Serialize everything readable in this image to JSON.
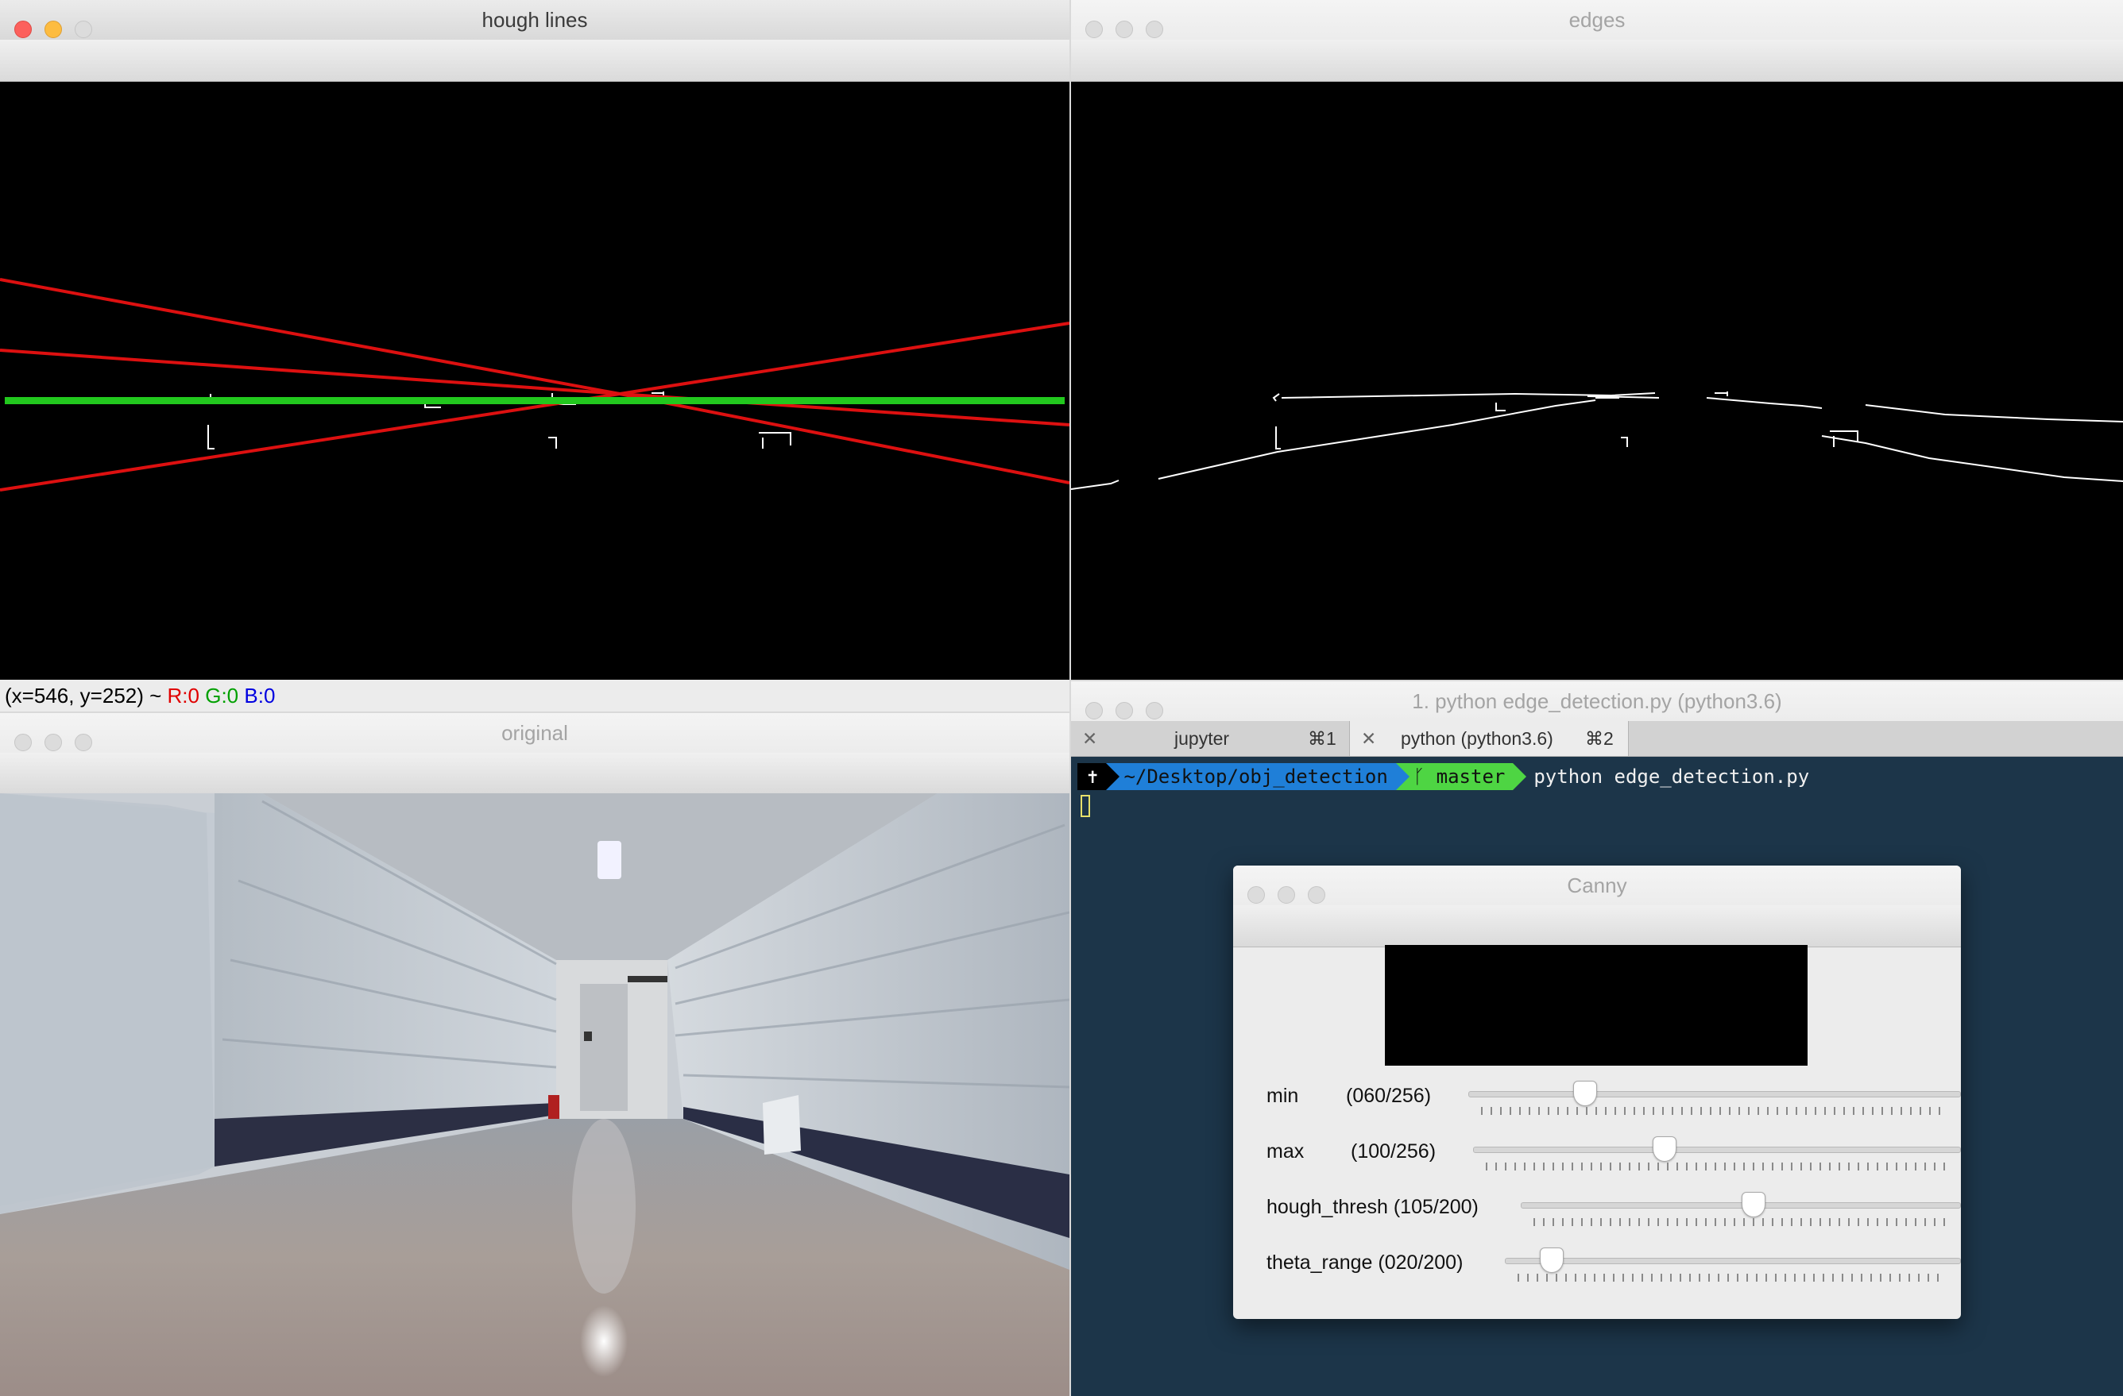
{
  "hough": {
    "title": "hough lines",
    "status": {
      "coords": "(x=546, y=252) ~ ",
      "r": "R:0",
      "g": "G:0",
      "b": "B:0"
    }
  },
  "edges": {
    "title": "edges"
  },
  "original": {
    "title": "original"
  },
  "terminal": {
    "title": "1. python edge_detection.py (python3.6)",
    "tabs": [
      {
        "label": "jupyter",
        "shortcut": "⌘1",
        "close": "✕"
      },
      {
        "label": "python (python3.6)",
        "shortcut": "⌘2",
        "close": "✕"
      }
    ],
    "prompt": {
      "root_glyph": "✝",
      "path": "~/Desktop/obj_detection",
      "branch_glyph": "ᚴ",
      "branch": "master",
      "command": "python edge_detection.py"
    }
  },
  "canny": {
    "title": "Canny",
    "sliders": [
      {
        "label": "min",
        "value": "(060/256)",
        "level": 0.234
      },
      {
        "label": "max",
        "value": "(100/256)",
        "level": 0.39
      },
      {
        "label": "hough_thresh (105/200)",
        "value": "",
        "level": 0.525
      },
      {
        "label": "theta_range (020/200)",
        "value": "",
        "level": 0.1
      }
    ]
  },
  "colors": {
    "red_line": "#dd1010",
    "green_line": "#22c81e",
    "terminal_bg": "#1c3549"
  }
}
